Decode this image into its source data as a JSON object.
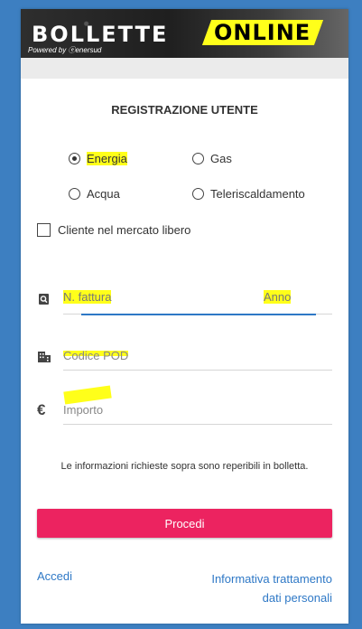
{
  "header": {
    "brand_left": "BOLLETTE",
    "brand_right": "ONLINE",
    "powered_by": "Powered by ⓔenersud"
  },
  "form": {
    "title": "REGISTRAZIONE UTENTE",
    "radios": [
      {
        "label": "Energia",
        "selected": true
      },
      {
        "label": "Gas",
        "selected": false
      },
      {
        "label": "Acqua",
        "selected": false
      },
      {
        "label": "Teleriscaldamento",
        "selected": false
      }
    ],
    "checkbox_label": "Cliente nel mercato libero",
    "fields": {
      "invoice_placeholder": "N. fattura",
      "year_placeholder": "Anno",
      "pod_placeholder": "Codice POD",
      "amount_placeholder": "Importo"
    },
    "info_note": "Le informazioni richieste sopra sono reperibili in bolletta.",
    "submit_label": "Procedi"
  },
  "footer": {
    "login_link": "Accedi",
    "privacy_link_line1": "Informativa trattamento",
    "privacy_link_line2": "dati personali"
  },
  "colors": {
    "page_background": "#3d7fc1",
    "button": "#ec2360",
    "link": "#2e78c6",
    "highlight": "#ffff1a",
    "active_underline": "#2e78c6"
  },
  "icons": [
    "search-document-icon",
    "building-icon",
    "euro-icon"
  ]
}
